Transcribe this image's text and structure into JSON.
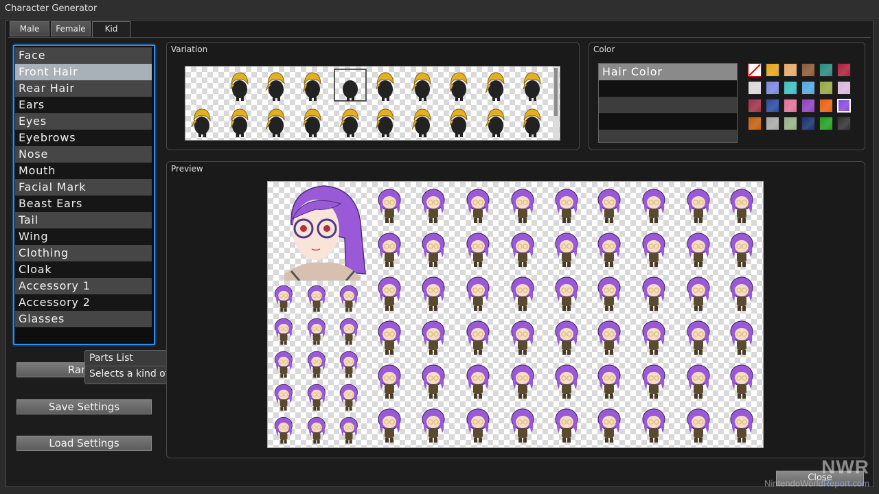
{
  "window": {
    "title": "Character Generator"
  },
  "tabs": [
    {
      "label": "Male"
    },
    {
      "label": "Female"
    },
    {
      "label": "Kid",
      "active": true
    }
  ],
  "parts_list": {
    "items": [
      "Face",
      "Front Hair",
      "Rear Hair",
      "Ears",
      "Eyes",
      "Eyebrows",
      "Nose",
      "Mouth",
      "Facial Mark",
      "Beast Ears",
      "Tail",
      "Wing",
      "Clothing",
      "Cloak",
      "Accessory 1",
      "Accessory 2",
      "Glasses"
    ],
    "selected": "Front Hair"
  },
  "buttons": {
    "random": "Rando",
    "save": "Save Settings",
    "load": "Load Settings",
    "close": "Close"
  },
  "tooltip": {
    "title": "Parts List",
    "text": "Selects a kind of parts."
  },
  "variation": {
    "label": "Variation",
    "selected_index": 3
  },
  "color": {
    "label": "Color",
    "items": [
      "Hair Color"
    ],
    "swatches": [
      "none",
      "#e6a41a",
      "#e6a868",
      "#8a5a36",
      "#2a8a80",
      "#b0203c",
      "#d8d8d8",
      "#7a88e0",
      "#38c0c0",
      "#50a8e0",
      "#98a840",
      "#d8b8d8",
      "#a03048",
      "#284aa0",
      "#e0709a",
      "#9040c0",
      "#e86010",
      "#8a4ae0",
      "#c06010",
      "#a8a8a8",
      "#98b088",
      "#183070",
      "#20a020",
      "#303030"
    ],
    "selected_swatch": 17,
    "accent": "#2f8ff0"
  },
  "preview": {
    "label": "Preview",
    "hair_color": "#9a5ad8"
  },
  "watermark": {
    "logo": "NWR",
    "site_a": "NintendoWorld",
    "site_b": "Report.com"
  }
}
